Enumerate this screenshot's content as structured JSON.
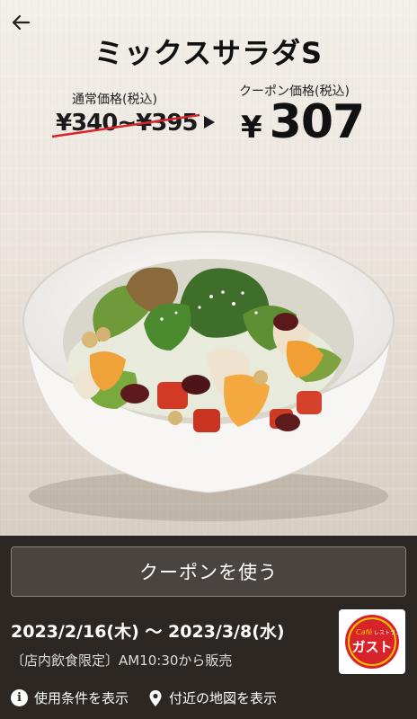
{
  "header": {
    "back_icon": "arrow-left-icon",
    "title": "ミックスサラダS"
  },
  "price": {
    "normal_label": "通常価格(税込)",
    "normal_value": "¥340~¥395",
    "coupon_label": "クーポン価格(税込)",
    "coupon_currency": "¥",
    "coupon_value": "307",
    "strike_color": "#d8232a",
    "arrow_icon": "triangle-right-icon"
  },
  "hero_image": {
    "icon": "mixed-salad-bowl-photo"
  },
  "coupon": {
    "use_button_label": "クーポンを使う",
    "period": "2023/2/16(木) 〜 2023/3/8(水)",
    "note": "〔店内飲食限定〕AM10:30から販売"
  },
  "brand": {
    "logo_cafe": "Café",
    "logo_small": "レストラン",
    "logo_name": "ガスト",
    "logo_color": "#d8232a",
    "logo_accent": "#f7c600"
  },
  "footer": {
    "terms_icon": "info-icon",
    "terms_label": "使用条件を表示",
    "map_icon": "location-pin-icon",
    "map_label": "付近の地図を表示"
  }
}
